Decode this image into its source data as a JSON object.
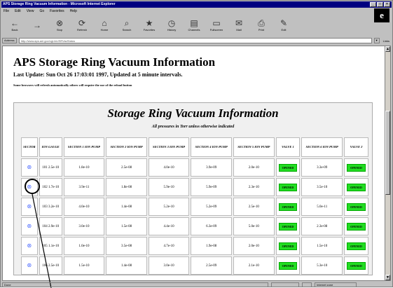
{
  "window": {
    "title": "APS Storage Ring Vacuum Information - Microsoft Internet Explorer",
    "menus": [
      "File",
      "Edit",
      "View",
      "Go",
      "Favorites",
      "Help"
    ],
    "toolbar": [
      {
        "label": "Back",
        "icon": "back-arrow-icon"
      },
      {
        "label": "",
        "icon": "forward-arrow-icon"
      },
      {
        "label": "Stop",
        "icon": "stop-icon"
      },
      {
        "label": "Refresh",
        "icon": "refresh-icon"
      },
      {
        "label": "Home",
        "icon": "home-icon"
      },
      {
        "label": "Search",
        "icon": "search-icon"
      },
      {
        "label": "Favorites",
        "icon": "favorites-icon"
      },
      {
        "label": "History",
        "icon": "history-icon"
      },
      {
        "label": "Channels",
        "icon": "channels-icon"
      },
      {
        "label": "Fullscreen",
        "icon": "fullscreen-icon"
      },
      {
        "label": "Mail",
        "icon": "mail-icon"
      },
      {
        "label": "Print",
        "icon": "print-icon"
      },
      {
        "label": "Edit",
        "icon": "edit-icon"
      }
    ],
    "address_label": "Address",
    "address_value": "http://www.aps.anl.gov/cgi-bin/SRVacStatus",
    "links_label": "Links",
    "status_left": "Done",
    "status_zone": "Internet zone"
  },
  "page": {
    "title": "APS Storage Ring Vacuum Information",
    "update": "Last Update: Sun Oct 26 17:03:01 1997, Updated at 5 minute intervals.",
    "note": "Some browsers will refresh automatically others will require the use of the reload button"
  },
  "table": {
    "title": "Storage Ring Vacuum Information",
    "subtitle": "All pressures in Torr unless otherwise indicated",
    "headers": [
      "SECTOR",
      "ION GAUGE",
      "SECTION 1 ION PUMP",
      "SECTION 2 ION PUMP",
      "SECTION 3 ION PUMP",
      "SECTION 4 ION PUMP",
      "SECTION 5 ION PUMP",
      "VALVE 1",
      "SECTION 6 ION PUMP",
      "VALVE 2"
    ],
    "rows": [
      [
        "01",
        "101 2.5e-10",
        "1.8e-10",
        "2.5e-08",
        "4.0e-10",
        "3.9e-09",
        "2.0e-10",
        "OPENED",
        "3.3e-09",
        "OPENED"
      ],
      [
        "02",
        "102 1.7e-10",
        "3.9e-11",
        "1.8e-08",
        "5.9e-10",
        "5.9e-09",
        "2.3e-10",
        "OPENED",
        "3.5e-10",
        "OPENED"
      ],
      [
        "03",
        "103 3.2e-10",
        "4.0e-10",
        "1.4e-08",
        "5.2e-10",
        "5.2e-09",
        "2.5e-10",
        "OPENED",
        "5.0e-11",
        "OPENED"
      ],
      [
        "04",
        "104 2.9e-10",
        "3.0e-10",
        "1.5e-08",
        "4.4e-10",
        "6.3e-09",
        "5.0e-10",
        "OPENED",
        "2.3e-08",
        "OPENED"
      ],
      [
        "05",
        "105 1.1e-10",
        "1.0e-10",
        "3.5e-08",
        "4.7e-10",
        "1.9e-08",
        "2.0e-10",
        "OPENED",
        "1.5e-10",
        "OPENED"
      ],
      [
        "06",
        "106 2.5e-10",
        "1.5e-10",
        "1.4e-08",
        "3.0e-10",
        "2.5e-09",
        "2.1e-10",
        "OPENED",
        "5.3e-10",
        "OPENED"
      ]
    ]
  },
  "colors": {
    "title_bar": "#000080",
    "opened_badge": "#22dd22",
    "sector_icon": "#4060ff"
  }
}
